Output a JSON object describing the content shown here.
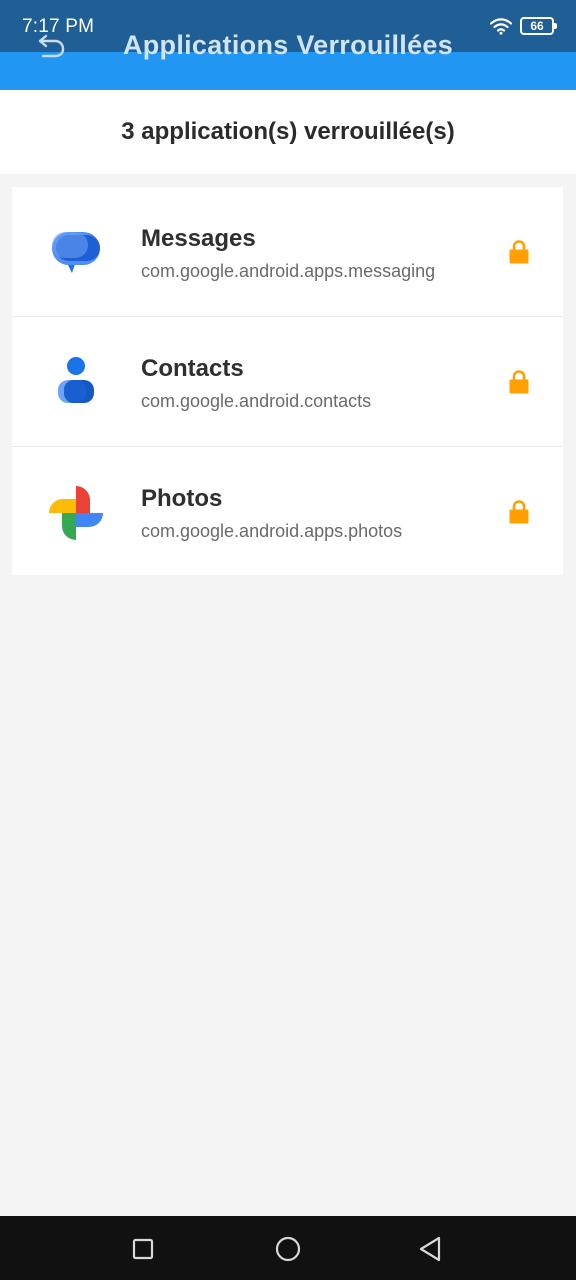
{
  "status_bar": {
    "time": "7:17 PM",
    "battery": "66",
    "icons": [
      "wifi-icon",
      "battery-icon"
    ]
  },
  "app_bar": {
    "title": "Applications Verrouillées",
    "back_icon": "back-arrow-icon",
    "color": "#2196f3"
  },
  "summary": {
    "text": "3 application(s) verrouillée(s)"
  },
  "apps": [
    {
      "name": "Messages",
      "package": "com.google.android.apps.messaging",
      "icon": "messages-icon",
      "lock_icon": "lock-icon"
    },
    {
      "name": "Contacts",
      "package": "com.google.android.contacts",
      "icon": "contacts-icon",
      "lock_icon": "lock-icon"
    },
    {
      "name": "Photos",
      "package": "com.google.android.apps.photos",
      "icon": "photos-icon",
      "lock_icon": "lock-icon"
    }
  ],
  "nav_bar": {
    "buttons": [
      "recents-icon",
      "home-icon",
      "back-icon"
    ]
  },
  "colors": {
    "accent": "#2196f3",
    "status_bar": "#1f5f95",
    "lock": "#ffa000"
  }
}
